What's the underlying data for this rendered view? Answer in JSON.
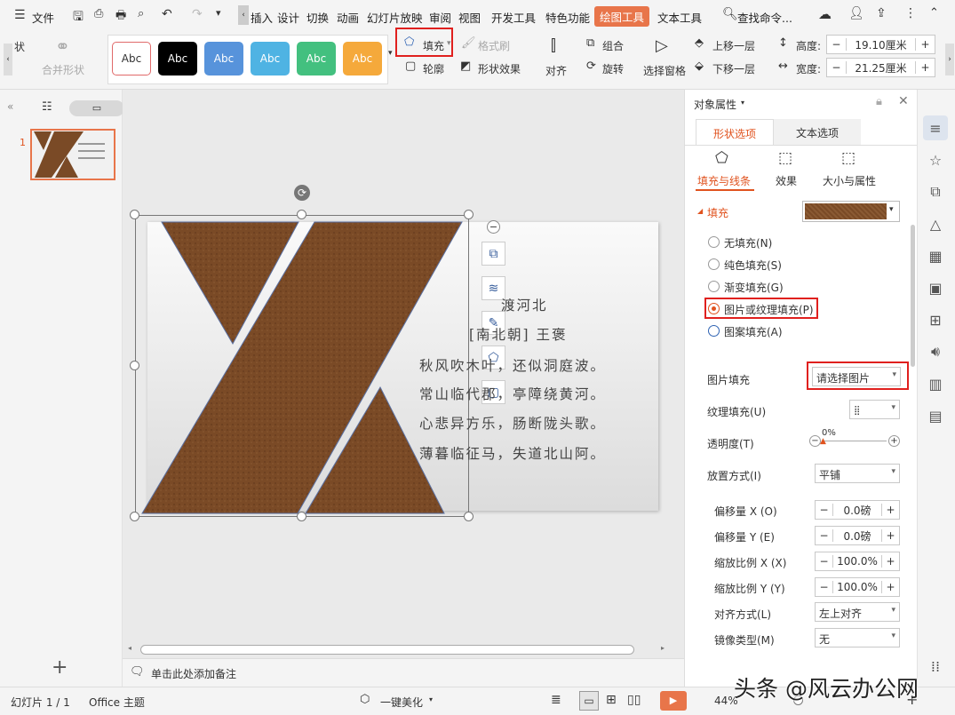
{
  "menubar": {
    "file": "文件",
    "tabs": [
      "插入",
      "设计",
      "切换",
      "动画",
      "幻灯片放映",
      "审阅",
      "视图",
      "开发工具",
      "特色功能",
      "绘图工具",
      "文本工具"
    ],
    "search": "查找命令..."
  },
  "ribbon": {
    "shape_label": "状",
    "merge_shape": "合并形状",
    "styles": [
      "Abc",
      "Abc",
      "Abc",
      "Abc",
      "Abc",
      "Abc"
    ],
    "fill": "填充",
    "format_painter": "格式刷",
    "outline": "轮廓",
    "shape_effect": "形状效果",
    "align": "对齐",
    "group": "组合",
    "rotate": "旋转",
    "selection_pane": "选择窗格",
    "bring_forward": "上移一层",
    "send_backward": "下移一层",
    "height_label": "高度:",
    "height_value": "19.10厘米",
    "width_label": "宽度:",
    "width_value": "21.25厘米"
  },
  "slide_panel": {
    "slide_number": "1"
  },
  "slide": {
    "title": "渡河北",
    "author": "[南北朝] 王褒",
    "lines": [
      "秋风吹木叶，还似洞庭波。",
      "常山临代郡，亭障绕黄河。",
      "心悲异方乐，肠断陇头歌。",
      "薄暮临征马，失道北山阿。"
    ]
  },
  "notes": "单击此处添加备注",
  "panel": {
    "title": "对象属性",
    "tab_shape": "形状选项",
    "tab_text": "文本选项",
    "sub_fill_line": "填充与线条",
    "sub_effect": "效果",
    "sub_size": "大小与属性",
    "fill_header": "填充",
    "radios": [
      "无填充(N)",
      "纯色填充(S)",
      "渐变填充(G)",
      "图片或纹理填充(P)",
      "图案填充(A)"
    ],
    "picture_fill_label": "图片填充",
    "picture_fill_value": "请选择图片",
    "texture_fill_label": "纹理填充(U)",
    "transparency_label": "透明度(T)",
    "transparency_value": "0%",
    "placement_label": "放置方式(I)",
    "placement_value": "平铺",
    "offset_x_label": "偏移量 X (O)",
    "offset_x": "0.0磅",
    "offset_y_label": "偏移量 Y (E)",
    "offset_y": "0.0磅",
    "scale_x_label": "缩放比例 X (X)",
    "scale_x": "100.0%",
    "scale_y_label": "缩放比例 Y (Y)",
    "scale_y": "100.0%",
    "align_label": "对齐方式(L)",
    "align_value": "左上对齐",
    "mirror_label": "镜像类型(M)",
    "mirror_value": "无"
  },
  "status": {
    "slide": "幻灯片 1 / 1",
    "theme": "Office 主题",
    "beautify": "一键美化",
    "zoom": "44%",
    "watermark": "头条 @风云办公网"
  },
  "colors": {
    "accent": "#e8754a",
    "leather": "#7a4a26",
    "highlight": "#e0201e",
    "link": "#2f63b3"
  }
}
